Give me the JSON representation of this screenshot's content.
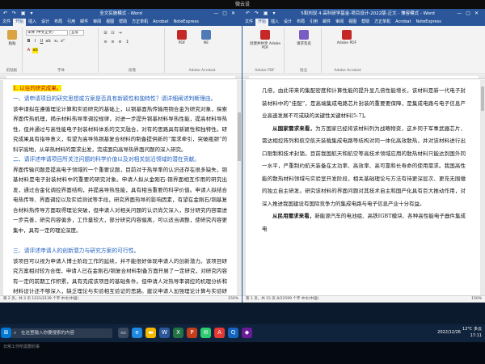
{
  "topbar_title": "微云设",
  "left_window": {
    "title": "全文实施模式 - Word",
    "qat": "↶ ↷ ▣ ▾",
    "tabs": [
      "文件",
      "开始",
      "插入",
      "设计",
      "布局",
      "引用",
      "邮件",
      "审阅",
      "视图",
      "帮助",
      "方正单机",
      "Acrobat",
      "NoteExpress"
    ],
    "active_tab": "开始",
    "font_name": "宋体 (中文正文)",
    "font_size": "五号",
    "ribbon_groups": [
      "剪贴板",
      "字体",
      "段落",
      "Adobe Acrobat"
    ],
    "doc": {
      "line1_highlight": "1. 以往的研究成果。",
      "h1": "一、请申请项目的研究思想或方案是否具有新颖性和独特性？请详细阐述判断理由。",
      "p1": "该申请拟在遵循理论计算和实验研究的基础上，以铜基面热传输用铜合金为研究对象，探索界面传热机理，揭示材料热导率调控规律，对进一步提升铜基材料导热性能，提高材料导热性，但并通过与高性能电子封装材料体系的交叉融合，对有的思路具有新颖性和独特性。研究成果具有指导意义，有望为高导热铜基复合材料的制备提供新的“需求牵引，突破瓶颈”的科学高地，从单热材料的需求出发，完成面向高导热界面问题的深入研究。",
      "h2": "二、请评述申请项目所关注问题的科学价值以及对相关前沿领域的潜在贡献。",
      "p2": "界面传输问题是提高电子领域的一个重要议题，目前对于热导率的认识还存在很多缺失，铜基材料是电子封装材料中的重要的研究对象。申请人拟从金刚石-铜界面相互作用的研究出发，通过合金化调控界面结构，并提高导热性能，具有相当重要的科学价值。申请人拟结合电热传导、界面调控以及实验测试等手段，研究界面热导的影响因素，有望在金刚石/铜基复合材料热传导方面取得理论突破，但申请人对相关问题的认识尚欠深入，部分研究内容需进一步完善，研究内容偏多，工作量较大，部分研究内容偏离，可以适当调整，使研究内容更集中，具有一定的理论深度。",
      "h3": "三、请评述申请人的创新潜力与研究方案的可行性。",
      "p3": "该项目可以视为申请人博士阶段工作的延续，并不能很好体现申请人的创新潜力。该项目研究方案相对较为合理，申请人已在金刚石/铜复合材料制备方面开展了一定研究，对研究内容有一定的前期工作积累，具有完成该项目的基础条件。但申请人对热导率调控的机理分析和材料设计还不够深入，缺乏理论与实验相互验证的思路。建议申请人加强理论计算与实验研究的结合，深入分析界面结构与热输运之间的内在联系。"
    },
    "status": "第 2 页，共 3 页   1221/2139 个字   中文(中国)",
    "zoom": "150%"
  },
  "right_window": {
    "title": "5和刘双 4 高科研学基金-项目设计-2022版-正文 - 兼容模式 - Word",
    "qat": "↶ ↷ ▣ ▾",
    "tabs": [
      "文件",
      "开始",
      "插入",
      "设计",
      "布局",
      "引用",
      "邮件",
      "审阅",
      "视图",
      "帮助",
      "方正单机",
      "Acrobat",
      "NoteExpress"
    ],
    "active_tab": "开始",
    "ribbon_groups": [
      "Adobe PDF",
      "批注",
      "Adobe Acrobat"
    ],
    "ribbon_tools": [
      "创建并共享 Adobe PDF",
      "请求签名",
      "Adobe PDF"
    ],
    "doc": {
      "p0": "几倍，由此带来的集配密度和计算性能的提升显几倍性能增长，该材料是新一代电子封装材料中的“佳配”，是高端集成电路芯片封装的重要要保障，是集成电路与电子信息产业高速发展不可或缺的关键性关键材料[5-7]。",
      "p1_lead": "从国家需求来看，",
      "p1": "为方国家已经将该材料列为战略物资，这乡同于军事武器芯片、需达相控阵列和航空航天装载集成电路等结构对同一体化高效散热，并对该材料进行出口限制和技术封锁。目前我国航天和航空等高技术领域应用的散热材料只能达到国外同一水平，严重制约航天装备在太功率、高效率、高可靠和长寿命的使用需求。我国高性能的散热材料领域与实验室开发阶段，相关基础理论与方法有待更深层次、更充无围缴的独立自主研发。研究该材料的界面问题对其技术自主和国产化具有巨大推动作用，对深入推进我国建设有国际竞争力的集成电路与电子信息产业十分有益。",
      "p2_lead": "从民用需求来看，",
      "p2": "新能源汽车的电池组、高铁IGBT模块、各种高性能电子器件集成电"
    },
    "status": "第 1 页，共 15 页   8/22599 个字   中文(中国)",
    "zoom": "150%"
  },
  "taskbar": {
    "search_placeholder": "在这里输入你要搜索的内容",
    "weather": "12°C 多云",
    "time": "17:11",
    "date": "2022/12/26",
    "bottom_note": "日常工作所需要的事"
  },
  "colors": {
    "word_blue": "#2b579a",
    "heading_blue": "#1f5fbf",
    "highlight": "#ffe600",
    "taskbar": "#10233d"
  }
}
